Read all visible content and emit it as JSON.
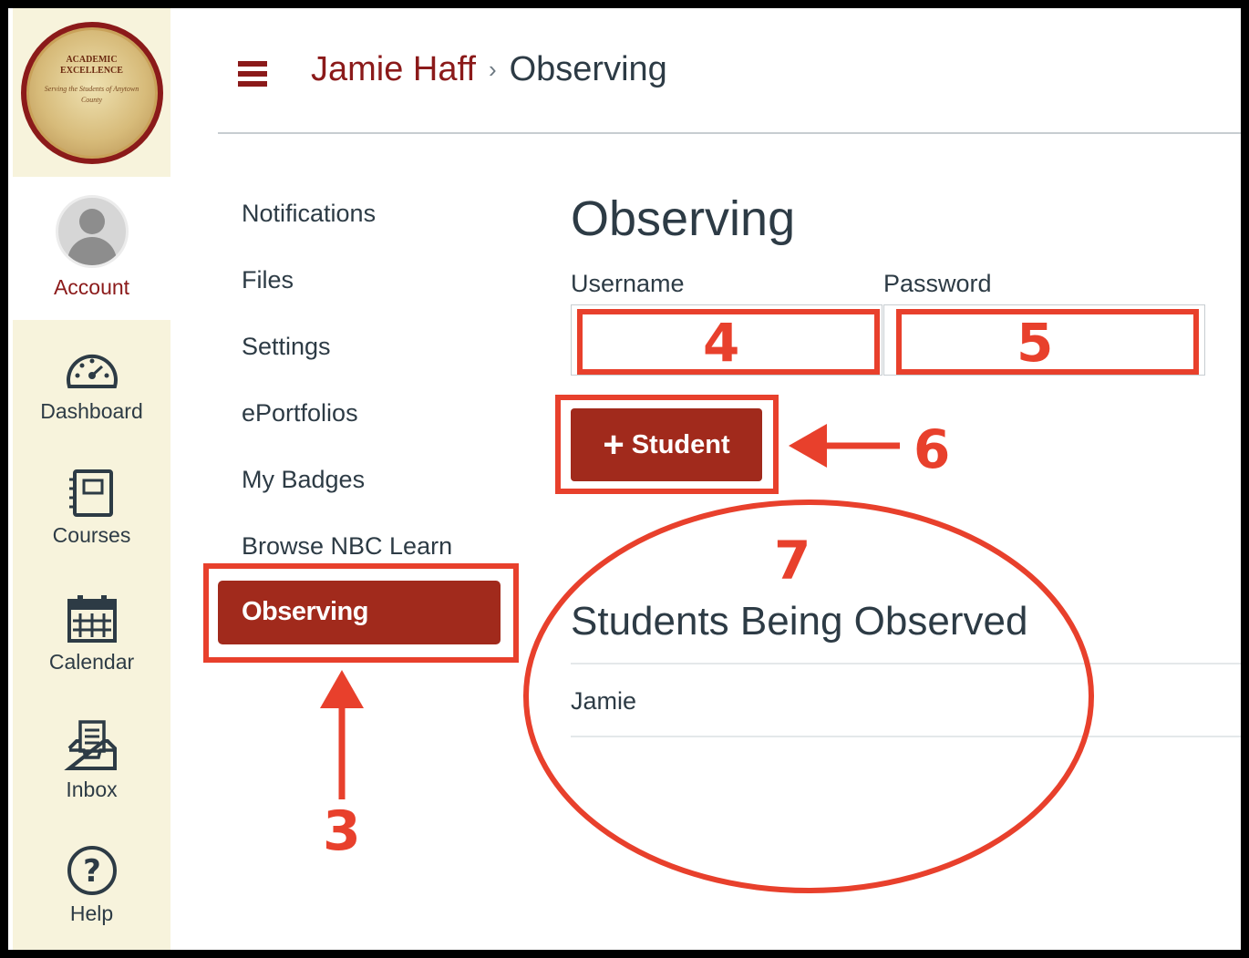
{
  "logo": {
    "line1": "ACADEMIC",
    "line2": "EXCELLENCE",
    "script": "Serving the Students of Anytown County"
  },
  "global_nav": {
    "account": "Account",
    "items": [
      {
        "label": "Dashboard",
        "icon": "dashboard-icon"
      },
      {
        "label": "Courses",
        "icon": "courses-icon"
      },
      {
        "label": "Calendar",
        "icon": "calendar-icon"
      },
      {
        "label": "Inbox",
        "icon": "inbox-icon"
      },
      {
        "label": "Help",
        "icon": "help-icon"
      }
    ]
  },
  "header": {
    "breadcrumb_user": "Jamie Haff",
    "separator": "›",
    "breadcrumb_current": "Observing"
  },
  "account_menu": {
    "items": [
      "Notifications",
      "Files",
      "Settings",
      "ePortfolios",
      "My Badges",
      "Browse NBC Learn"
    ],
    "active": "Observing"
  },
  "main": {
    "title": "Observing",
    "username_label": "Username",
    "password_label": "Password",
    "username_value": "",
    "password_value": "",
    "add_button": "Student",
    "observed_heading": "Students Being Observed",
    "students": [
      "Jamie"
    ]
  },
  "annotations": {
    "n3": "3",
    "n4": "4",
    "n5": "5",
    "n6": "6",
    "n7": "7"
  },
  "colors": {
    "brand": "#a12a1c",
    "annotation": "#e8402c",
    "text": "#2d3b45",
    "nav_bg": "#f7f3dc"
  }
}
